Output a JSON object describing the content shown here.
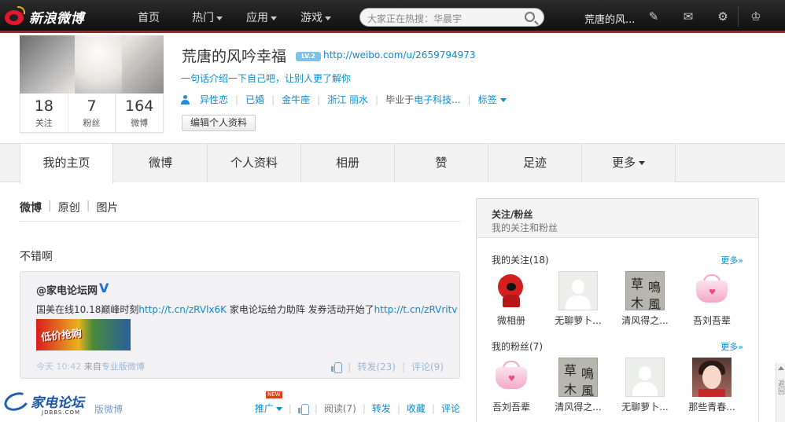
{
  "topbar": {
    "logo_text": "新浪微博",
    "nav": [
      {
        "label": "首页"
      },
      {
        "label": "热门"
      },
      {
        "label": "应用"
      },
      {
        "label": "游戏"
      }
    ],
    "search_placeholder": "大家正在热搜：华晨宇",
    "user_name": "荒唐的风...",
    "icons": [
      "edit-icon",
      "mail-icon",
      "gear-icon",
      "crown-icon"
    ]
  },
  "profile": {
    "counts": [
      {
        "num": "18",
        "label": "关注"
      },
      {
        "num": "7",
        "label": "粉丝"
      },
      {
        "num": "164",
        "label": "微博"
      }
    ],
    "nickname": "荒唐的风吟幸福",
    "level_badge": "LV.2",
    "home_url": "http://weibo.com/u/2659794973",
    "intro": "一句话介绍一下自己吧，让别人更了解你",
    "meta": {
      "orientation": "异性恋",
      "relationship": "已婚",
      "zodiac": "金牛座",
      "location": "浙江 丽水",
      "school_prefix": "毕业于",
      "school": "电子科技...",
      "tags_label": "标签"
    },
    "edit_button": "编辑个人资料"
  },
  "tabs": [
    {
      "label": "我的主页",
      "active": true
    },
    {
      "label": "微博"
    },
    {
      "label": "个人资料"
    },
    {
      "label": "相册"
    },
    {
      "label": "赞"
    },
    {
      "label": "足迹"
    },
    {
      "label": "更多"
    }
  ],
  "feed": {
    "filters": [
      "微博",
      "原创",
      "图片"
    ],
    "post": {
      "text": "不错啊",
      "repost": {
        "author": "@家电论坛网",
        "verified_badge": "V",
        "text_parts": [
          "国美在线10.18巅峰时刻",
          "http://t.cn/zRVlx6K",
          " 家电论坛给力助阵 发券活动开始了",
          "http://t.cn/zRVritv"
        ],
        "image_text": "低价抢购",
        "time": "今天 10:42",
        "source_prefix": "来自",
        "source": "专业版微博",
        "forward": "转发(23)",
        "comment": "评论(9)"
      },
      "footer": {
        "brand": "家电论坛",
        "brand_sub": "JDBBS.COM",
        "source_tail": "版微博",
        "promote": "推广",
        "new_badge": "NEW",
        "read": "阅读(7)",
        "forward": "转发",
        "favorite": "收藏",
        "comment": "评论"
      }
    }
  },
  "sidebar": {
    "title": "关注/粉丝",
    "subtitle": "我的关注和粉丝",
    "following_title": "我的关注(18)",
    "followers_title": "我的粉丝(7)",
    "more_label": "更多»",
    "following": [
      {
        "name": "微相册",
        "avatar": "red-mascot"
      },
      {
        "name": "无聊萝卜...",
        "avatar": "default"
      },
      {
        "name": "清风得之...",
        "avatar": "calligraphy"
      },
      {
        "name": "吾刘吾辈",
        "avatar": "pink-bag"
      }
    ],
    "followers": [
      {
        "name": "吾刘吾辈",
        "avatar": "pink-bag"
      },
      {
        "name": "清风得之...",
        "avatar": "calligraphy"
      },
      {
        "name": "无聊萝卜...",
        "avatar": "default"
      },
      {
        "name": "那些青春...",
        "avatar": "girl-photo"
      }
    ],
    "calligraphy_chars": [
      "草",
      "鳴",
      "木",
      "風"
    ]
  },
  "scrollbar_text": "返回"
}
